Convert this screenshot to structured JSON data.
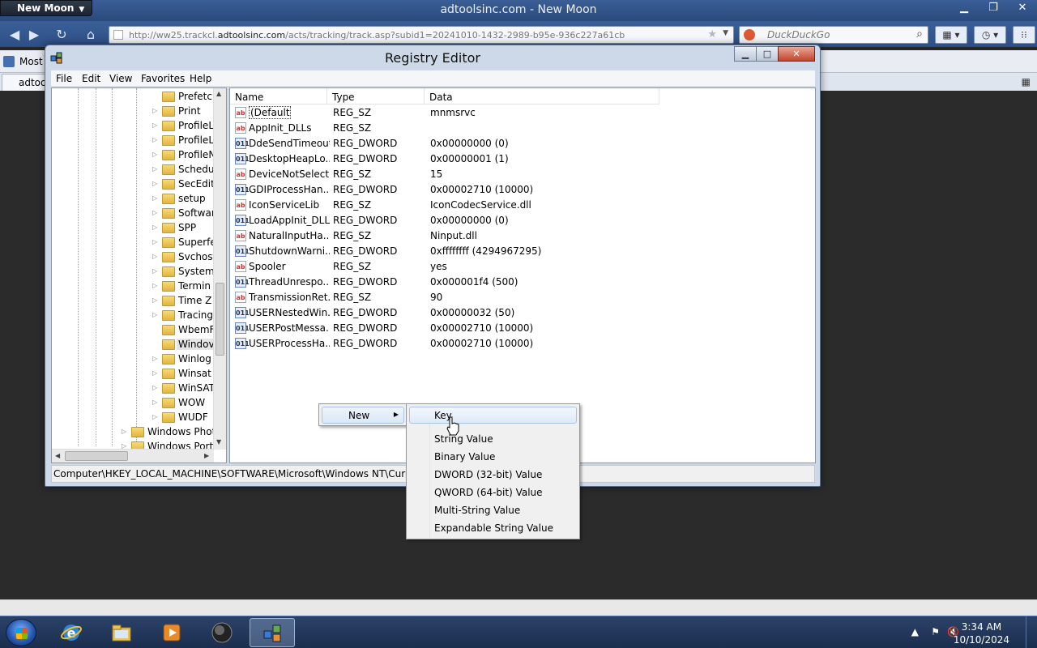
{
  "browser": {
    "app_button": "New Moon",
    "window_title": "adtoolsinc.com - New Moon",
    "url_prefix": "http://ww25.trackcl.",
    "url_host": "adtoolsinc.com",
    "url_path": "/acts/tracking/track.asp?subid1=20241010-1432-2989-b95e-936c227a61cb",
    "search_placeholder": "DuckDuckGo",
    "bookmark_label": "Most",
    "tab_label": "adtoo"
  },
  "regedit": {
    "title": "Registry Editor",
    "menu": [
      "File",
      "Edit",
      "View",
      "Favorites",
      "Help"
    ],
    "tree": [
      {
        "label": "Prefetc",
        "expander": "",
        "level": 2
      },
      {
        "label": "Print",
        "expander": "▷",
        "level": 2
      },
      {
        "label": "ProfileL",
        "expander": "▷",
        "level": 2
      },
      {
        "label": "ProfileL",
        "expander": "▷",
        "level": 2
      },
      {
        "label": "ProfileN",
        "expander": "▷",
        "level": 2
      },
      {
        "label": "Schedu",
        "expander": "▷",
        "level": 2
      },
      {
        "label": "SecEdit",
        "expander": "▷",
        "level": 2
      },
      {
        "label": "setup",
        "expander": "▷",
        "level": 2
      },
      {
        "label": "Softwar",
        "expander": "▷",
        "level": 2
      },
      {
        "label": "SPP",
        "expander": "▷",
        "level": 2
      },
      {
        "label": "Superfe",
        "expander": "▷",
        "level": 2
      },
      {
        "label": "Svchost",
        "expander": "▷",
        "level": 2
      },
      {
        "label": "System",
        "expander": "▷",
        "level": 2
      },
      {
        "label": "Termin",
        "expander": "▷",
        "level": 2
      },
      {
        "label": "Time Z",
        "expander": "▷",
        "level": 2
      },
      {
        "label": "Tracing",
        "expander": "▷",
        "level": 2
      },
      {
        "label": "WbemF",
        "expander": "",
        "level": 2
      },
      {
        "label": "Windov",
        "expander": "",
        "level": 2,
        "selected": true
      },
      {
        "label": "Winlog",
        "expander": "▷",
        "level": 2
      },
      {
        "label": "Winsat",
        "expander": "▷",
        "level": 2
      },
      {
        "label": "WinSAT",
        "expander": "▷",
        "level": 2
      },
      {
        "label": "WOW",
        "expander": "▷",
        "level": 2
      },
      {
        "label": "WUDF",
        "expander": "▷",
        "level": 2
      },
      {
        "label": "Windows Phot",
        "expander": "▷",
        "level": 1
      },
      {
        "label": "Windows Port",
        "expander": "▷",
        "level": 1
      }
    ],
    "columns": {
      "name": "Name",
      "type": "Type",
      "data": "Data"
    },
    "values": [
      {
        "icon": "ab",
        "name": "(Default)",
        "type": "REG_SZ",
        "data": "mnmsrvc",
        "selected": true
      },
      {
        "icon": "ab",
        "name": "AppInit_DLLs",
        "type": "REG_SZ",
        "data": ""
      },
      {
        "icon": "011",
        "name": "DdeSendTimeout",
        "type": "REG_DWORD",
        "data": "0x00000000 (0)"
      },
      {
        "icon": "011",
        "name": "DesktopHeapLo...",
        "type": "REG_DWORD",
        "data": "0x00000001 (1)"
      },
      {
        "icon": "ab",
        "name": "DeviceNotSelect...",
        "type": "REG_SZ",
        "data": "15"
      },
      {
        "icon": "011",
        "name": "GDIProcessHan...",
        "type": "REG_DWORD",
        "data": "0x00002710 (10000)"
      },
      {
        "icon": "ab",
        "name": "IconServiceLib",
        "type": "REG_SZ",
        "data": "IconCodecService.dll"
      },
      {
        "icon": "011",
        "name": "LoadAppInit_DLLs",
        "type": "REG_DWORD",
        "data": "0x00000000 (0)"
      },
      {
        "icon": "ab",
        "name": "NaturalInputHa...",
        "type": "REG_SZ",
        "data": "Ninput.dll"
      },
      {
        "icon": "011",
        "name": "ShutdownWarni...",
        "type": "REG_DWORD",
        "data": "0xffffffff (4294967295)"
      },
      {
        "icon": "ab",
        "name": "Spooler",
        "type": "REG_SZ",
        "data": "yes"
      },
      {
        "icon": "011",
        "name": "ThreadUnrespo...",
        "type": "REG_DWORD",
        "data": "0x000001f4 (500)"
      },
      {
        "icon": "ab",
        "name": "TransmissionRet...",
        "type": "REG_SZ",
        "data": "90"
      },
      {
        "icon": "011",
        "name": "USERNestedWin...",
        "type": "REG_DWORD",
        "data": "0x00000032 (50)"
      },
      {
        "icon": "011",
        "name": "USERPostMessa...",
        "type": "REG_DWORD",
        "data": "0x00002710 (10000)"
      },
      {
        "icon": "011",
        "name": "USERProcessHa...",
        "type": "REG_DWORD",
        "data": "0x00002710 (10000)"
      }
    ],
    "status_path": "Computer\\HKEY_LOCAL_MACHINE\\SOFTWARE\\Microsoft\\Windows NT\\CurrentVe"
  },
  "context_menu": {
    "parent_label": "New",
    "items": [
      "Key",
      "String Value",
      "Binary Value",
      "DWORD (32-bit) Value",
      "QWORD (64-bit) Value",
      "Multi-String Value",
      "Expandable String Value"
    ],
    "highlighted": "Key"
  },
  "taskbar": {
    "time": "3:34 AM",
    "date": "10/10/2024"
  },
  "colors": {
    "selection_blue": "#dbe8f6",
    "taskbar": "#1b2e4e",
    "browser_chrome": "#2d4f86"
  }
}
